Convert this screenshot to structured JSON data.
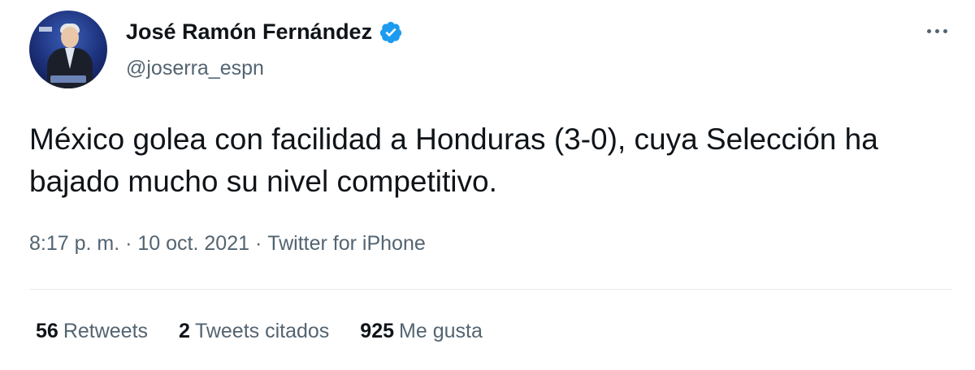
{
  "tweet": {
    "author": {
      "name": "José Ramón Fernández",
      "handle": "@joserra_espn",
      "verified": true
    },
    "text": "México golea con facilidad a Honduras (3-0), cuya Selección ha bajado mucho su nivel competitivo.",
    "time": "8:17 p. m.",
    "date": "10 oct. 2021",
    "source": "Twitter for iPhone",
    "separator": " · ",
    "stats": [
      {
        "count": "56",
        "label": "Retweets"
      },
      {
        "count": "2",
        "label": "Tweets citados"
      },
      {
        "count": "925",
        "label": "Me gusta"
      }
    ]
  },
  "icons": {
    "verified": "verified-badge-icon",
    "more": "more-options-icon"
  },
  "colors": {
    "verified_blue": "#1d9bf0",
    "secondary_text": "#536471",
    "primary_text": "#0f1419",
    "divider": "#e6ecf0"
  }
}
